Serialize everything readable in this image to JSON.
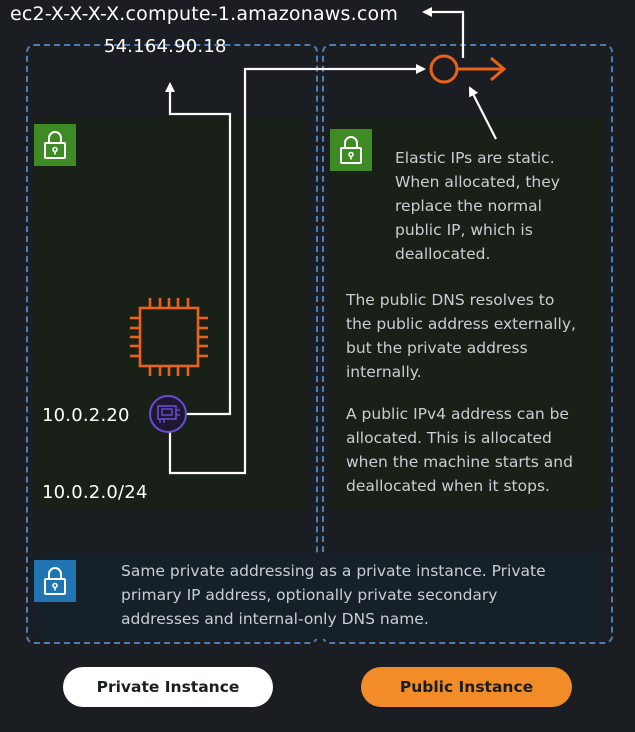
{
  "labels": {
    "public_dns": "ec2-X-X-X-X.compute-1.amazonaws.com",
    "public_ip": "54.164.90.18",
    "private_ip": "10.0.2.20",
    "subnet_cidr": "10.0.2.0/24"
  },
  "notes": {
    "elastic_ip": "Elastic IPs are static.\nWhen allocated, they\nreplace the normal\npublic IP, which is\ndeallocated.",
    "dns": "The public DNS resolves to\nthe public address externally,\nbut the private address\ninternally.",
    "ipv4": "A public IPv4 address can be\nallocated. This is allocated\nwhen the machine starts and\ndeallocated when it stops.",
    "shared": "Same private addressing as a private instance. Private\nprimary IP address, optionally private secondary\naddresses and internal-only DNS name."
  },
  "buttons": {
    "private": "Private Instance",
    "public": "Public Instance"
  },
  "icons": {
    "lock": "lock-icon",
    "chip": "ec2-instance-chip-icon",
    "eni": "network-interface-icon",
    "elastic_ip": "elastic-ip-icon"
  },
  "colors": {
    "background": "#1a1d21",
    "dashed_border": "#4e7db3",
    "subnet_green": "#3e8a25",
    "vpc_blue": "#1f74b1",
    "accent_orange": "#e8621c",
    "eni_purple": "#6a4bd6",
    "public_button": "#f28c28",
    "private_button": "#ffffff"
  }
}
